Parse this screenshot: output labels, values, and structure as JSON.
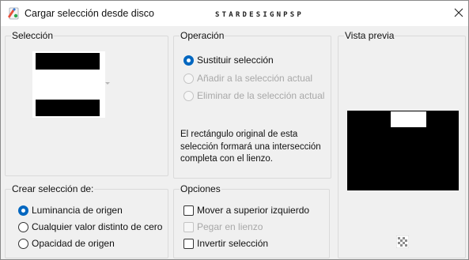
{
  "window": {
    "title": "Cargar selección desde disco",
    "watermark": "STARDESIGNPSP",
    "close_glyph": "✕"
  },
  "seleccion": {
    "label": "Selección",
    "preview_icon": "selection-thumbnail",
    "dropdown_icon": "chevron-down-icon"
  },
  "operacion": {
    "label": "Operación",
    "options": [
      {
        "label": "Sustituir selección",
        "checked": true,
        "enabled": true
      },
      {
        "label": "Añadir a la selección actual",
        "checked": false,
        "enabled": false
      },
      {
        "label": "Eliminar de la selección actual",
        "checked": false,
        "enabled": false
      }
    ],
    "description": "El rectángulo original de esta selección formará una intersección completa con el lienzo."
  },
  "vista_previa": {
    "label": "Vista previa",
    "toggle_icon": "checker-icon"
  },
  "crear": {
    "label": "Crear selección de:",
    "options": [
      {
        "label": "Luminancia de origen",
        "checked": true,
        "enabled": true
      },
      {
        "label": "Cualquier valor distinto de cero",
        "checked": false,
        "enabled": true
      },
      {
        "label": "Opacidad de origen",
        "checked": false,
        "enabled": true
      }
    ]
  },
  "opciones": {
    "label": "Opciones",
    "options": [
      {
        "label": "Mover a superior izquierdo",
        "checked": false,
        "enabled": true
      },
      {
        "label": "Pegar en lienzo",
        "checked": false,
        "enabled": false
      },
      {
        "label": "Invertir selección",
        "checked": false,
        "enabled": true
      }
    ]
  },
  "colors": {
    "accent": "#0067c0",
    "dialog_bg": "#f0f0f0",
    "disabled_text": "#a8a8a8"
  }
}
